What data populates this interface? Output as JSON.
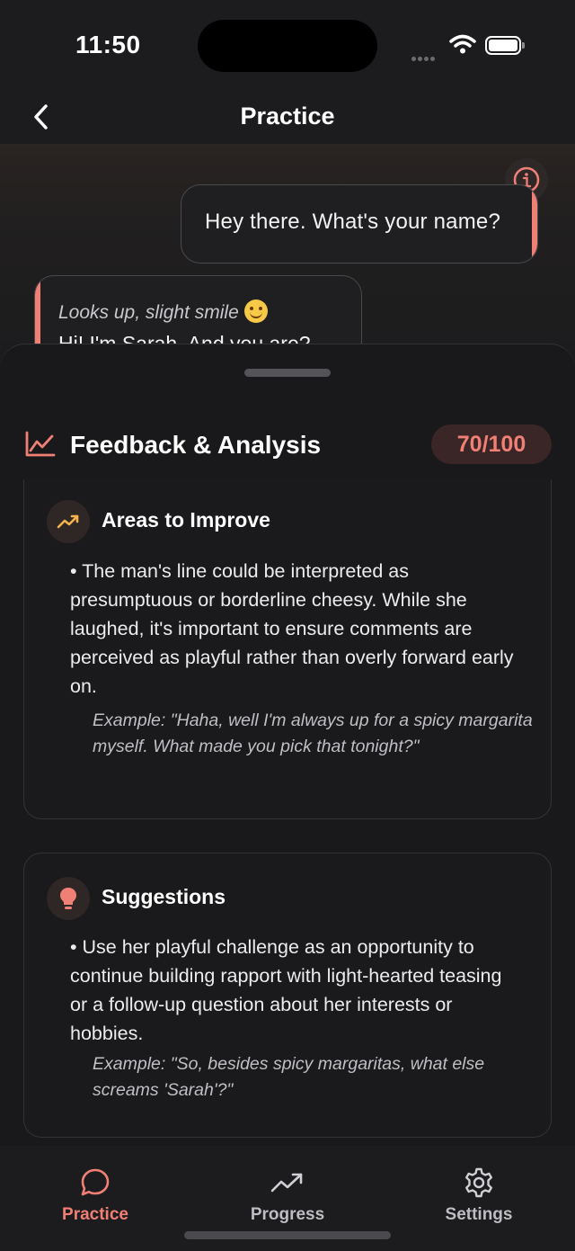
{
  "status": {
    "time": "11:50"
  },
  "nav": {
    "title": "Practice"
  },
  "chat": {
    "user_message": "Hey there. What's your name?",
    "ai_action": "Looks up, slight smile",
    "ai_reply": "Hi! I'm Sarah. And you are?"
  },
  "feedback": {
    "title": "Feedback & Analysis",
    "score": "70/100",
    "sections": [
      {
        "title": "Areas to Improve",
        "icon": "trend-up-icon",
        "body": "• The man's line could be interpreted as presumptuous or borderline cheesy. While she laughed, it's important to ensure comments are perceived as playful rather than overly forward early on.",
        "example": "Example: \"Haha, well I'm always up for a spicy margarita myself. What made you pick that tonight?\""
      },
      {
        "title": "Suggestions",
        "icon": "lightbulb-icon",
        "body": "• Use her playful challenge as an opportunity to continue building rapport with light-hearted teasing or a follow-up question about her interests or hobbies.",
        "example": "Example: \"So, besides spicy margaritas, what else screams 'Sarah'?\""
      }
    ]
  },
  "tabs": [
    {
      "label": "Practice",
      "icon": "chat-bubble-icon",
      "active": true
    },
    {
      "label": "Progress",
      "icon": "trend-icon",
      "active": false
    },
    {
      "label": "Settings",
      "icon": "gear-icon",
      "active": false
    }
  ],
  "colors": {
    "accent": "#f07f75",
    "background": "#1c1c1e",
    "amber": "#f5b34a"
  }
}
